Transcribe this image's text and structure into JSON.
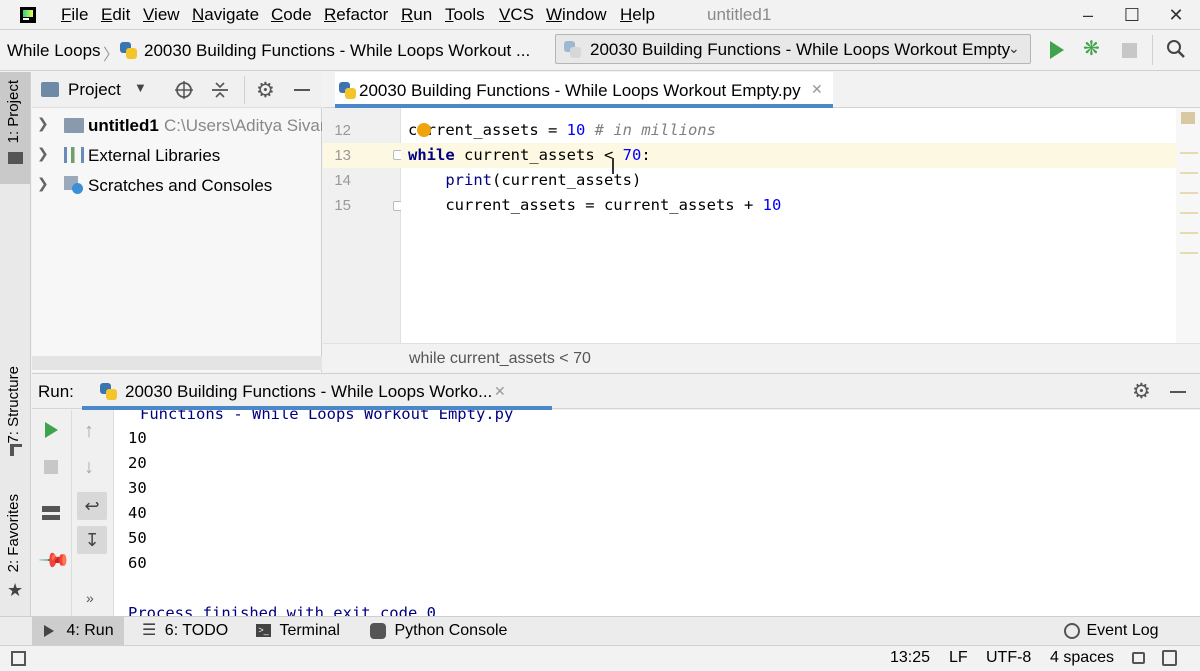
{
  "menubar": {
    "items": [
      "File",
      "Edit",
      "View",
      "Navigate",
      "Code",
      "Refactor",
      "Run",
      "Tools",
      "VCS",
      "Window",
      "Help"
    ],
    "window_title": "untitled1"
  },
  "navbar": {
    "breadcrumb_folder": "While Loops",
    "breadcrumb_file": "20030 Building Functions - While Loops Workout ...",
    "run_config": "20030 Building Functions - While Loops Workout Empty"
  },
  "leftstrip": {
    "project_tab": "1: Project",
    "structure_tab": "7: Structure",
    "favorites_tab": "2: Favorites"
  },
  "project": {
    "header_label": "Project",
    "root_name": "untitled1",
    "root_path": "C:\\Users\\Aditya Sivar",
    "external_libraries": "External Libraries",
    "scratches": "Scratches and Consoles"
  },
  "editor": {
    "tab_label": "20030 Building Functions - While Loops Workout Empty.py",
    "lines": [
      {
        "number": "12",
        "var": "current_assets",
        "op": " = ",
        "value": "10",
        "comment": " # in millions"
      },
      {
        "number": "13",
        "keyword": "while",
        "rest": " current_assets < ",
        "value": "70",
        "end": ":"
      },
      {
        "number": "14",
        "indent": "    ",
        "fn": "print",
        "args": "(current_assets)"
      },
      {
        "number": "15",
        "indent": "    ",
        "lhs": "current_assets = current_assets + ",
        "value": "10"
      }
    ],
    "breadcrumb": "while current_assets < 70"
  },
  "run": {
    "label": "Run:",
    "tab_label": "20030 Building Functions - While Loops Worko...",
    "cut_line": "Functions - While Loops Workout Empty.py",
    "output": [
      "10",
      "20",
      "30",
      "40",
      "50",
      "60"
    ],
    "finished_line": "Process finished with exit code 0"
  },
  "bottombar": {
    "run_tab": "4: Run",
    "todo_tab": "6: TODO",
    "terminal_tab": "Terminal",
    "python_console_tab": "Python Console",
    "event_log": "Event Log"
  },
  "statusbar": {
    "position": "13:25",
    "line_sep": "LF",
    "encoding": "UTF-8",
    "indent": "4 spaces"
  },
  "colors": {
    "accent_blue": "#4a88c7",
    "run_green": "#3fa34d",
    "keyword": "#000080",
    "number": "#0000ff",
    "current_line": "#fdf8e1"
  }
}
